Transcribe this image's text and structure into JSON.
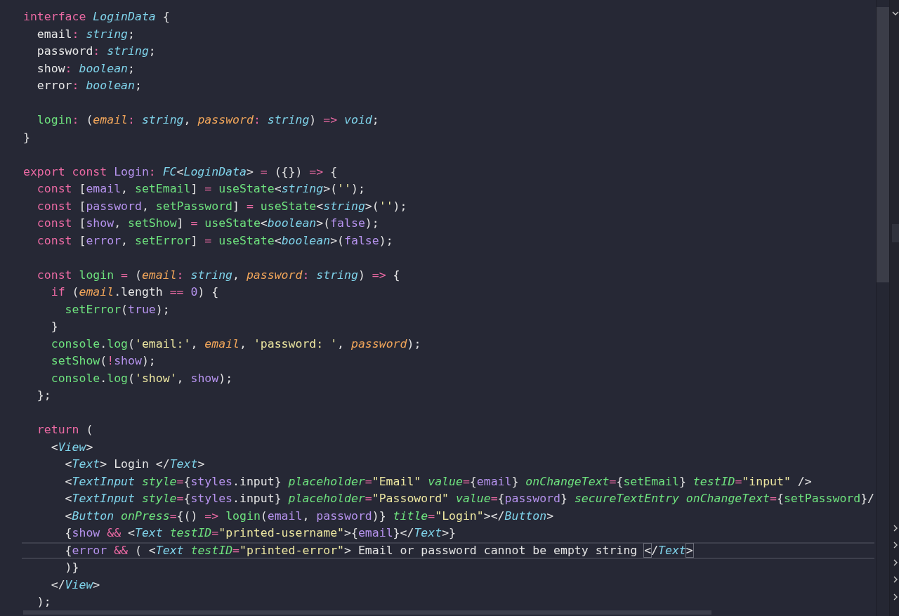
{
  "editor": {
    "lines": [
      {
        "current": false,
        "tokens": [
          {
            "kind": "keyword",
            "text": "interface "
          },
          {
            "kind": "type",
            "text": "LoginData"
          },
          {
            "kind": "punct",
            "text": " {"
          }
        ]
      },
      {
        "current": false,
        "tokens": [
          {
            "kind": "property",
            "text": "  email"
          },
          {
            "kind": "operator",
            "text": ": "
          },
          {
            "kind": "type",
            "text": "string"
          },
          {
            "kind": "punct",
            "text": ";"
          }
        ]
      },
      {
        "current": false,
        "tokens": [
          {
            "kind": "property",
            "text": "  password"
          },
          {
            "kind": "operator",
            "text": ": "
          },
          {
            "kind": "type",
            "text": "string"
          },
          {
            "kind": "punct",
            "text": ";"
          }
        ]
      },
      {
        "current": false,
        "tokens": [
          {
            "kind": "property",
            "text": "  show"
          },
          {
            "kind": "operator",
            "text": ": "
          },
          {
            "kind": "type",
            "text": "boolean"
          },
          {
            "kind": "punct",
            "text": ";"
          }
        ]
      },
      {
        "current": false,
        "tokens": [
          {
            "kind": "property",
            "text": "  error"
          },
          {
            "kind": "operator",
            "text": ": "
          },
          {
            "kind": "type",
            "text": "boolean"
          },
          {
            "kind": "punct",
            "text": ";"
          }
        ]
      },
      {
        "current": false
      },
      {
        "current": false,
        "tokens": [
          {
            "kind": "function",
            "text": "  login"
          },
          {
            "kind": "operator",
            "text": ": "
          },
          {
            "kind": "punct",
            "text": "("
          },
          {
            "kind": "param",
            "text": "email"
          },
          {
            "kind": "operator",
            "text": ": "
          },
          {
            "kind": "type",
            "text": "string"
          },
          {
            "kind": "punct",
            "text": ", "
          },
          {
            "kind": "param",
            "text": "password"
          },
          {
            "kind": "operator",
            "text": ": "
          },
          {
            "kind": "type",
            "text": "string"
          },
          {
            "kind": "punct",
            "text": ") "
          },
          {
            "kind": "operator",
            "text": "=> "
          },
          {
            "kind": "type",
            "text": "void"
          },
          {
            "kind": "punct",
            "text": ";"
          }
        ]
      },
      {
        "current": false,
        "tokens": [
          {
            "kind": "punct",
            "text": "}"
          }
        ]
      },
      {
        "current": false
      },
      {
        "current": false,
        "tokens": [
          {
            "kind": "keyword",
            "text": "export const "
          },
          {
            "kind": "name",
            "text": "Login"
          },
          {
            "kind": "operator",
            "text": ": "
          },
          {
            "kind": "type",
            "text": "FC"
          },
          {
            "kind": "punct",
            "text": "<"
          },
          {
            "kind": "type",
            "text": "LoginData"
          },
          {
            "kind": "punct",
            "text": "> "
          },
          {
            "kind": "operator",
            "text": "= "
          },
          {
            "kind": "punct",
            "text": "({}) "
          },
          {
            "kind": "operator",
            "text": "=> "
          },
          {
            "kind": "punct",
            "text": "{"
          }
        ]
      },
      {
        "current": false,
        "tokens": [
          {
            "kind": "keyword",
            "text": "  const "
          },
          {
            "kind": "punct",
            "text": "["
          },
          {
            "kind": "name",
            "text": "email"
          },
          {
            "kind": "punct",
            "text": ", "
          },
          {
            "kind": "function",
            "text": "setEmail"
          },
          {
            "kind": "punct",
            "text": "] "
          },
          {
            "kind": "operator",
            "text": "= "
          },
          {
            "kind": "function",
            "text": "useState"
          },
          {
            "kind": "punct",
            "text": "<"
          },
          {
            "kind": "type",
            "text": "string"
          },
          {
            "kind": "punct",
            "text": ">("
          },
          {
            "kind": "string",
            "text": "''"
          },
          {
            "kind": "punct",
            "text": ");"
          }
        ]
      },
      {
        "current": false,
        "tokens": [
          {
            "kind": "keyword",
            "text": "  const "
          },
          {
            "kind": "punct",
            "text": "["
          },
          {
            "kind": "name",
            "text": "password"
          },
          {
            "kind": "punct",
            "text": ", "
          },
          {
            "kind": "function",
            "text": "setPassword"
          },
          {
            "kind": "punct",
            "text": "] "
          },
          {
            "kind": "operator",
            "text": "= "
          },
          {
            "kind": "function",
            "text": "useState"
          },
          {
            "kind": "punct",
            "text": "<"
          },
          {
            "kind": "type",
            "text": "string"
          },
          {
            "kind": "punct",
            "text": ">("
          },
          {
            "kind": "string",
            "text": "''"
          },
          {
            "kind": "punct",
            "text": ");"
          }
        ]
      },
      {
        "current": false,
        "tokens": [
          {
            "kind": "keyword",
            "text": "  const "
          },
          {
            "kind": "punct",
            "text": "["
          },
          {
            "kind": "name",
            "text": "show"
          },
          {
            "kind": "punct",
            "text": ", "
          },
          {
            "kind": "function",
            "text": "setShow"
          },
          {
            "kind": "punct",
            "text": "] "
          },
          {
            "kind": "operator",
            "text": "= "
          },
          {
            "kind": "function",
            "text": "useState"
          },
          {
            "kind": "punct",
            "text": "<"
          },
          {
            "kind": "type",
            "text": "boolean"
          },
          {
            "kind": "punct",
            "text": ">("
          },
          {
            "kind": "name",
            "text": "false"
          },
          {
            "kind": "punct",
            "text": ");"
          }
        ]
      },
      {
        "current": false,
        "tokens": [
          {
            "kind": "keyword",
            "text": "  const "
          },
          {
            "kind": "punct",
            "text": "["
          },
          {
            "kind": "name",
            "text": "error"
          },
          {
            "kind": "punct",
            "text": ", "
          },
          {
            "kind": "function",
            "text": "setError"
          },
          {
            "kind": "punct",
            "text": "] "
          },
          {
            "kind": "operator",
            "text": "= "
          },
          {
            "kind": "function",
            "text": "useState"
          },
          {
            "kind": "punct",
            "text": "<"
          },
          {
            "kind": "type",
            "text": "boolean"
          },
          {
            "kind": "punct",
            "text": ">("
          },
          {
            "kind": "name",
            "text": "false"
          },
          {
            "kind": "punct",
            "text": ");"
          }
        ]
      },
      {
        "current": false
      },
      {
        "current": false,
        "tokens": [
          {
            "kind": "keyword",
            "text": "  const "
          },
          {
            "kind": "function",
            "text": "login "
          },
          {
            "kind": "operator",
            "text": "= "
          },
          {
            "kind": "punct",
            "text": "("
          },
          {
            "kind": "param",
            "text": "email"
          },
          {
            "kind": "operator",
            "text": ": "
          },
          {
            "kind": "type",
            "text": "string"
          },
          {
            "kind": "punct",
            "text": ", "
          },
          {
            "kind": "param",
            "text": "password"
          },
          {
            "kind": "operator",
            "text": ": "
          },
          {
            "kind": "type",
            "text": "string"
          },
          {
            "kind": "punct",
            "text": ") "
          },
          {
            "kind": "operator",
            "text": "=> "
          },
          {
            "kind": "punct",
            "text": "{"
          }
        ]
      },
      {
        "current": false,
        "tokens": [
          {
            "kind": "keyword",
            "text": "    if "
          },
          {
            "kind": "punct",
            "text": "("
          },
          {
            "kind": "param",
            "text": "email"
          },
          {
            "kind": "punct",
            "text": "."
          },
          {
            "kind": "property",
            "text": "length "
          },
          {
            "kind": "operator",
            "text": "== "
          },
          {
            "kind": "name",
            "text": "0"
          },
          {
            "kind": "punct",
            "text": ") {"
          }
        ]
      },
      {
        "current": false,
        "tokens": [
          {
            "kind": "function",
            "text": "      setError"
          },
          {
            "kind": "punct",
            "text": "("
          },
          {
            "kind": "name",
            "text": "true"
          },
          {
            "kind": "punct",
            "text": ");"
          }
        ]
      },
      {
        "current": false,
        "tokens": [
          {
            "kind": "punct",
            "text": "    }"
          }
        ]
      },
      {
        "current": false,
        "tokens": [
          {
            "kind": "function",
            "text": "    console"
          },
          {
            "kind": "punct",
            "text": "."
          },
          {
            "kind": "function",
            "text": "log"
          },
          {
            "kind": "punct",
            "text": "("
          },
          {
            "kind": "string",
            "text": "'email:'"
          },
          {
            "kind": "punct",
            "text": ", "
          },
          {
            "kind": "param",
            "text": "email"
          },
          {
            "kind": "punct",
            "text": ", "
          },
          {
            "kind": "string",
            "text": "'password: '"
          },
          {
            "kind": "punct",
            "text": ", "
          },
          {
            "kind": "param",
            "text": "password"
          },
          {
            "kind": "punct",
            "text": ");"
          }
        ]
      },
      {
        "current": false,
        "tokens": [
          {
            "kind": "function",
            "text": "    setShow"
          },
          {
            "kind": "punct",
            "text": "("
          },
          {
            "kind": "operator",
            "text": "!"
          },
          {
            "kind": "name",
            "text": "show"
          },
          {
            "kind": "punct",
            "text": ");"
          }
        ]
      },
      {
        "current": false,
        "tokens": [
          {
            "kind": "function",
            "text": "    console"
          },
          {
            "kind": "punct",
            "text": "."
          },
          {
            "kind": "function",
            "text": "log"
          },
          {
            "kind": "punct",
            "text": "("
          },
          {
            "kind": "string",
            "text": "'show'"
          },
          {
            "kind": "punct",
            "text": ", "
          },
          {
            "kind": "name",
            "text": "show"
          },
          {
            "kind": "punct",
            "text": ");"
          }
        ]
      },
      {
        "current": false,
        "tokens": [
          {
            "kind": "punct",
            "text": "  };"
          }
        ]
      },
      {
        "current": false
      },
      {
        "current": false,
        "tokens": [
          {
            "kind": "keyword",
            "text": "  return "
          },
          {
            "kind": "punct",
            "text": "("
          }
        ]
      },
      {
        "current": false,
        "tokens": [
          {
            "kind": "punct",
            "text": "    <"
          },
          {
            "kind": "tag",
            "text": "View"
          },
          {
            "kind": "punct",
            "text": ">"
          }
        ]
      },
      {
        "current": false,
        "tokens": [
          {
            "kind": "punct",
            "text": "      <"
          },
          {
            "kind": "tag",
            "text": "Text"
          },
          {
            "kind": "punct",
            "text": "> Login </"
          },
          {
            "kind": "tag",
            "text": "Text"
          },
          {
            "kind": "punct",
            "text": ">"
          }
        ]
      },
      {
        "current": false,
        "tokens": [
          {
            "kind": "punct",
            "text": "      <"
          },
          {
            "kind": "tag",
            "text": "TextInput"
          },
          {
            "kind": "attribute",
            "text": " style"
          },
          {
            "kind": "operator",
            "text": "="
          },
          {
            "kind": "punct",
            "text": "{"
          },
          {
            "kind": "name",
            "text": "styles"
          },
          {
            "kind": "punct",
            "text": ".input} "
          },
          {
            "kind": "attribute",
            "text": "placeholder"
          },
          {
            "kind": "operator",
            "text": "="
          },
          {
            "kind": "string",
            "text": "\"Email\""
          },
          {
            "kind": "attribute",
            "text": " value"
          },
          {
            "kind": "operator",
            "text": "="
          },
          {
            "kind": "punct",
            "text": "{"
          },
          {
            "kind": "name",
            "text": "email"
          },
          {
            "kind": "punct",
            "text": "} "
          },
          {
            "kind": "attribute",
            "text": "onChangeText"
          },
          {
            "kind": "operator",
            "text": "="
          },
          {
            "kind": "punct",
            "text": "{"
          },
          {
            "kind": "function",
            "text": "setEmail"
          },
          {
            "kind": "punct",
            "text": "} "
          },
          {
            "kind": "attribute",
            "text": "testID"
          },
          {
            "kind": "operator",
            "text": "="
          },
          {
            "kind": "string",
            "text": "\"input\""
          },
          {
            "kind": "punct",
            "text": " />"
          }
        ]
      },
      {
        "current": false,
        "tokens": [
          {
            "kind": "punct",
            "text": "      <"
          },
          {
            "kind": "tag",
            "text": "TextInput"
          },
          {
            "kind": "attribute",
            "text": " style"
          },
          {
            "kind": "operator",
            "text": "="
          },
          {
            "kind": "punct",
            "text": "{"
          },
          {
            "kind": "name",
            "text": "styles"
          },
          {
            "kind": "punct",
            "text": ".input} "
          },
          {
            "kind": "attribute",
            "text": "placeholder"
          },
          {
            "kind": "operator",
            "text": "="
          },
          {
            "kind": "string",
            "text": "\"Passoword\""
          },
          {
            "kind": "attribute",
            "text": " value"
          },
          {
            "kind": "operator",
            "text": "="
          },
          {
            "kind": "punct",
            "text": "{"
          },
          {
            "kind": "name",
            "text": "password"
          },
          {
            "kind": "punct",
            "text": "} "
          },
          {
            "kind": "attribute",
            "text": "secureTextEntry onChangeText"
          },
          {
            "kind": "operator",
            "text": "="
          },
          {
            "kind": "punct",
            "text": "{"
          },
          {
            "kind": "function",
            "text": "setPassword"
          },
          {
            "kind": "punct",
            "text": "}/"
          }
        ]
      },
      {
        "current": false,
        "tokens": [
          {
            "kind": "punct",
            "text": "      <"
          },
          {
            "kind": "tag",
            "text": "Button"
          },
          {
            "kind": "attribute",
            "text": " onPress"
          },
          {
            "kind": "operator",
            "text": "="
          },
          {
            "kind": "punct",
            "text": "{() "
          },
          {
            "kind": "operator",
            "text": "=> "
          },
          {
            "kind": "function",
            "text": "login"
          },
          {
            "kind": "punct",
            "text": "("
          },
          {
            "kind": "name",
            "text": "email"
          },
          {
            "kind": "punct",
            "text": ", "
          },
          {
            "kind": "name",
            "text": "password"
          },
          {
            "kind": "punct",
            "text": ")} "
          },
          {
            "kind": "attribute",
            "text": "title"
          },
          {
            "kind": "operator",
            "text": "="
          },
          {
            "kind": "string",
            "text": "\"Login\""
          },
          {
            "kind": "punct",
            "text": "></"
          },
          {
            "kind": "tag",
            "text": "Button"
          },
          {
            "kind": "punct",
            "text": ">"
          }
        ]
      },
      {
        "current": false,
        "tokens": [
          {
            "kind": "punct",
            "text": "      {"
          },
          {
            "kind": "name",
            "text": "show "
          },
          {
            "kind": "operator",
            "text": "&& "
          },
          {
            "kind": "punct",
            "text": "<"
          },
          {
            "kind": "tag",
            "text": "Text"
          },
          {
            "kind": "attribute",
            "text": " testID"
          },
          {
            "kind": "operator",
            "text": "="
          },
          {
            "kind": "string",
            "text": "\"printed-username\""
          },
          {
            "kind": "punct",
            "text": ">{"
          },
          {
            "kind": "name",
            "text": "email"
          },
          {
            "kind": "punct",
            "text": "}</"
          },
          {
            "kind": "tag",
            "text": "Text"
          },
          {
            "kind": "punct",
            "text": ">}"
          }
        ]
      },
      {
        "current": true,
        "tokens": [
          {
            "kind": "punct",
            "text": "      {"
          },
          {
            "kind": "name",
            "text": "error "
          },
          {
            "kind": "operator",
            "text": "&& "
          },
          {
            "kind": "punct",
            "text": "( <"
          },
          {
            "kind": "tag",
            "text": "Text"
          },
          {
            "kind": "attribute",
            "text": " testID"
          },
          {
            "kind": "operator",
            "text": "="
          },
          {
            "kind": "string",
            "text": "\"printed-error\""
          },
          {
            "kind": "punct",
            "text": "> Email or password cannot be empty string "
          },
          {
            "kind": "match",
            "text": "<"
          },
          {
            "kind": "punct",
            "text": "/"
          },
          {
            "kind": "tag",
            "text": "Text"
          },
          {
            "kind": "match",
            "text": ">"
          }
        ]
      },
      {
        "current": false,
        "tokens": [
          {
            "kind": "punct",
            "text": "      )}"
          }
        ]
      },
      {
        "current": false,
        "tokens": [
          {
            "kind": "punct",
            "text": "    </"
          },
          {
            "kind": "tag",
            "text": "View"
          },
          {
            "kind": "punct",
            "text": ">"
          }
        ]
      },
      {
        "current": false,
        "tokens": [
          {
            "kind": "punct",
            "text": "  );"
          }
        ]
      }
    ]
  }
}
